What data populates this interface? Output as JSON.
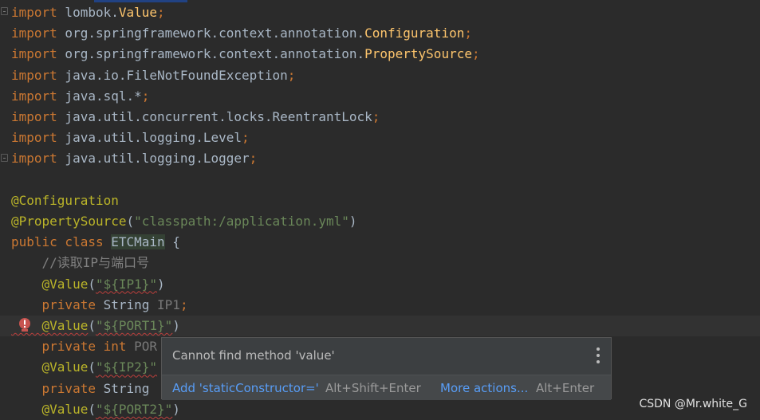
{
  "editor": {
    "lines": [
      {
        "id": "l1",
        "parts": [
          [
            "kw",
            "import"
          ],
          [
            "ty",
            " lombok."
          ],
          [
            "yl",
            "Value"
          ],
          [
            "kw",
            ";"
          ]
        ]
      },
      {
        "id": "l2",
        "parts": [
          [
            "kw",
            "import"
          ],
          [
            "ty",
            " org.springframework.context.annotation."
          ],
          [
            "yl",
            "Configuration"
          ],
          [
            "kw",
            ";"
          ]
        ]
      },
      {
        "id": "l3",
        "parts": [
          [
            "kw",
            "import"
          ],
          [
            "ty",
            " org.springframework.context.annotation."
          ],
          [
            "yl",
            "PropertySource"
          ],
          [
            "kw",
            ";"
          ]
        ]
      },
      {
        "id": "l4",
        "parts": [
          [
            "kw",
            "import"
          ],
          [
            "ty",
            " java.io.FileNotFoundException"
          ],
          [
            "kw",
            ";"
          ]
        ]
      },
      {
        "id": "l5",
        "parts": [
          [
            "kw",
            "import"
          ],
          [
            "ty",
            " java.sql.*"
          ],
          [
            "kw",
            ";"
          ]
        ]
      },
      {
        "id": "l6",
        "parts": [
          [
            "kw",
            "import"
          ],
          [
            "ty",
            " java.util.concurrent.locks.ReentrantLock"
          ],
          [
            "kw",
            ";"
          ]
        ]
      },
      {
        "id": "l7",
        "parts": [
          [
            "kw",
            "import"
          ],
          [
            "ty",
            " java.util.logging.Level"
          ],
          [
            "kw",
            ";"
          ]
        ]
      },
      {
        "id": "l8",
        "parts": [
          [
            "kw",
            "import"
          ],
          [
            "ty",
            " java.util.logging.Logger"
          ],
          [
            "kw",
            ";"
          ]
        ]
      },
      {
        "id": "l9",
        "parts": []
      },
      {
        "id": "l10",
        "parts": [
          [
            "ann",
            "@Configuration"
          ]
        ]
      },
      {
        "id": "l11",
        "parts": [
          [
            "ann",
            "@PropertySource"
          ],
          [
            "ty",
            "("
          ],
          [
            "str",
            "\"classpath:/application.yml\""
          ],
          [
            "ty",
            ")"
          ]
        ]
      },
      {
        "id": "l12",
        "parts": [
          [
            "kw",
            "public class "
          ],
          [
            "hl",
            "ETCMain"
          ],
          [
            "ty",
            " {"
          ]
        ]
      },
      {
        "id": "l13",
        "parts": [
          [
            "cm",
            "    //读取IP与端口号"
          ]
        ]
      },
      {
        "id": "l14",
        "parts": [
          [
            "ann",
            "    @Value"
          ],
          [
            "ty",
            "("
          ],
          [
            "strsq",
            "\"${IP1}\""
          ],
          [
            "ty",
            ")"
          ]
        ]
      },
      {
        "id": "l15",
        "parts": [
          [
            "kw",
            "    private "
          ],
          [
            "ty",
            "String "
          ],
          [
            "dim",
            "IP1"
          ],
          [
            "kw",
            ";"
          ]
        ]
      },
      {
        "id": "l16",
        "parts": [
          [
            "annsq",
            "    @Value"
          ],
          [
            "ty",
            "("
          ],
          [
            "strsq",
            "\"${PORT1}\""
          ],
          [
            "ty",
            ")"
          ]
        ]
      },
      {
        "id": "l17",
        "parts": [
          [
            "kw",
            "    private int "
          ],
          [
            "dim",
            "POR"
          ]
        ]
      },
      {
        "id": "l18",
        "parts": [
          [
            "ann",
            "    @Value"
          ],
          [
            "ty",
            "("
          ],
          [
            "strsq",
            "\"${IP2}\""
          ]
        ]
      },
      {
        "id": "l19",
        "parts": [
          [
            "kw",
            "    private "
          ],
          [
            "ty",
            "String"
          ]
        ]
      },
      {
        "id": "l20",
        "parts": [
          [
            "ann",
            "    @Value"
          ],
          [
            "ty",
            "("
          ],
          [
            "strsq",
            "\"${PORT2}\""
          ],
          [
            "ty",
            ")"
          ]
        ]
      }
    ]
  },
  "tooltip": {
    "message": "Cannot find method 'value'",
    "fix_label": "Add 'staticConstructor='",
    "fix_shortcut": "Alt+Shift+Enter",
    "more_label": "More actions...",
    "more_shortcut": "Alt+Enter"
  },
  "watermark": "CSDN @Mr.white_G",
  "icons": {
    "error": "error-bulb-icon",
    "menu": "more-vertical-icon",
    "fold": "fold-marker-icon"
  }
}
